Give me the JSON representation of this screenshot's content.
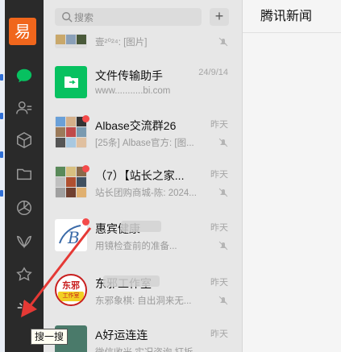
{
  "app": {
    "avatar_char": "易"
  },
  "search": {
    "placeholder": "搜索"
  },
  "toolbar": {
    "add_label": "+"
  },
  "chats": [
    {
      "name": "",
      "msg": "壹²⁰²⁴: [图片]",
      "time": ""
    },
    {
      "name": "文件传输助手",
      "msg": "www...........bi.com",
      "time": "24/9/14"
    },
    {
      "name": "Albase交流群26",
      "msg": "[25条] Albase官方: [图...",
      "time": "昨天"
    },
    {
      "name": "（7）【站长之家...",
      "msg": "站长团购商城-陈: 2024...",
      "time": "昨天"
    },
    {
      "name": "惠宾健康",
      "msg": "用镜检查前的准备...",
      "time": "昨天"
    },
    {
      "name": "东邪工作室",
      "msg": "东邪象棋: 自出洞来无...",
      "time": "昨天",
      "badge_top": "东邪",
      "badge_bottom": "工作室"
    },
    {
      "name": "A好运连连",
      "msg": "微信收米 实况咨询 打折",
      "time": "昨天"
    }
  ],
  "right": {
    "title": "腾讯新闻"
  },
  "tooltip": {
    "text": "搜一搜"
  },
  "colors": {
    "sidebar": "#2a2a2a",
    "accent": "#07c160",
    "list_bg": "#e7e7e7",
    "arrow": "#e53935",
    "unread": "#f44b4b"
  }
}
